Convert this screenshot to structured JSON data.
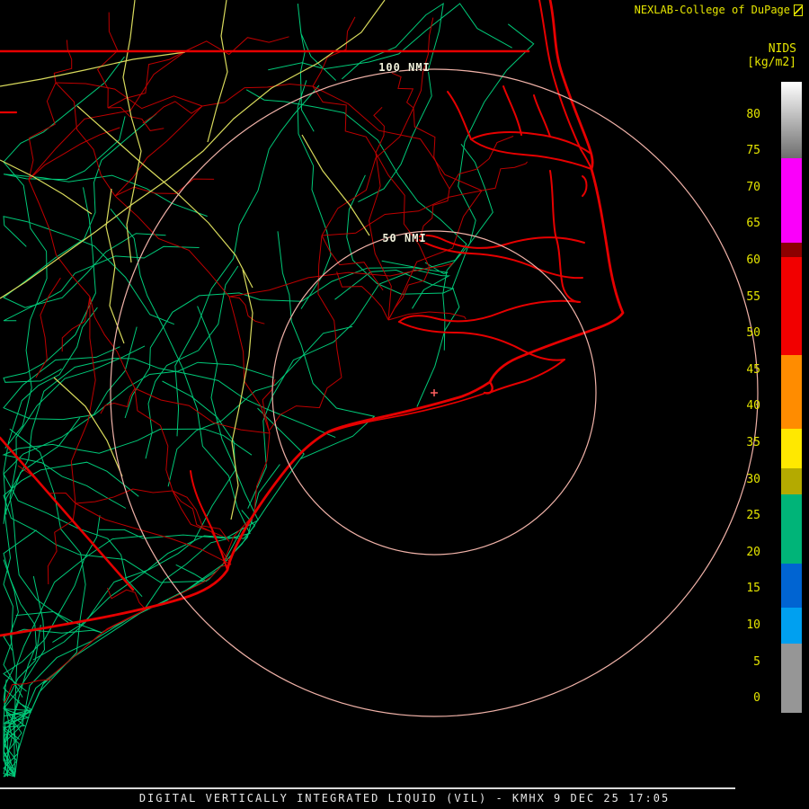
{
  "header": {
    "brand": "NEXLAB-College of DuPage",
    "scale_title": "NIDS",
    "scale_units": "[kg/m2]"
  },
  "rings": {
    "outer_label": "100 NMI",
    "inner_label": "50 NMI"
  },
  "colorbar": {
    "ticks": [
      80,
      75,
      70,
      65,
      60,
      55,
      50,
      45,
      40,
      35,
      30,
      25,
      20,
      15,
      10,
      5,
      0
    ],
    "segments": [
      {
        "from": 84.5,
        "to": 74,
        "color": "#ffffff",
        "gradient_to": "#6e6e6e"
      },
      {
        "from": 74,
        "to": 62.5,
        "color": "#fa00fa"
      },
      {
        "from": 62.5,
        "to": 60.5,
        "color": "#8c0000"
      },
      {
        "from": 60.5,
        "to": 47,
        "color": "#f20000"
      },
      {
        "from": 47,
        "to": 37,
        "color": "#ff8c00"
      },
      {
        "from": 37,
        "to": 31.5,
        "color": "#ffe800"
      },
      {
        "from": 31.5,
        "to": 28,
        "color": "#b4aa00"
      },
      {
        "from": 28,
        "to": 18.5,
        "color": "#00b478"
      },
      {
        "from": 18.5,
        "to": 12.5,
        "color": "#0064d2"
      },
      {
        "from": 12.5,
        "to": 7.5,
        "color": "#00a0f0"
      },
      {
        "from": 7.5,
        "to": -2,
        "color": "#969696"
      }
    ]
  },
  "footer": {
    "caption": "DIGITAL VERTICALLY INTEGRATED LIQUID (VIL) - KMHX 9 DEC 25 17:05"
  },
  "colors": {
    "background": "#000000",
    "brand_text": "#e6e600",
    "tick_text": "#e6e600",
    "ring": "#f0b2a8",
    "ring_label_text": "#f2f2dc",
    "coastline": "#e60000",
    "county_road": "#be0000",
    "road_green": "#00c878",
    "road_yellow": "#d8da5c",
    "footer_text": "#e8e8e8",
    "divider": "#d8d8d8"
  }
}
